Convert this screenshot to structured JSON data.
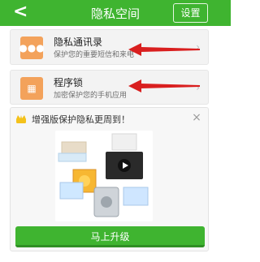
{
  "header": {
    "title": "隐私空间",
    "settings_label": "设置",
    "back_label": "<"
  },
  "items": [
    {
      "title": "隐私通讯录",
      "subtitle": "保护您的重要短信和来电",
      "icon": "privacy-contacts-icon"
    },
    {
      "title": "程序锁",
      "subtitle": "加密保护您的手机应用",
      "icon": "app-lock-icon"
    }
  ],
  "promo": {
    "text": "增强版保护隐私更周到！",
    "close_label": "×",
    "cta_label": "马上升级"
  },
  "colors": {
    "primary": "#3fb430",
    "item_icon": "#f3a25b",
    "arrow": "#d91f1f",
    "card_bg": "#f3f3f3"
  }
}
